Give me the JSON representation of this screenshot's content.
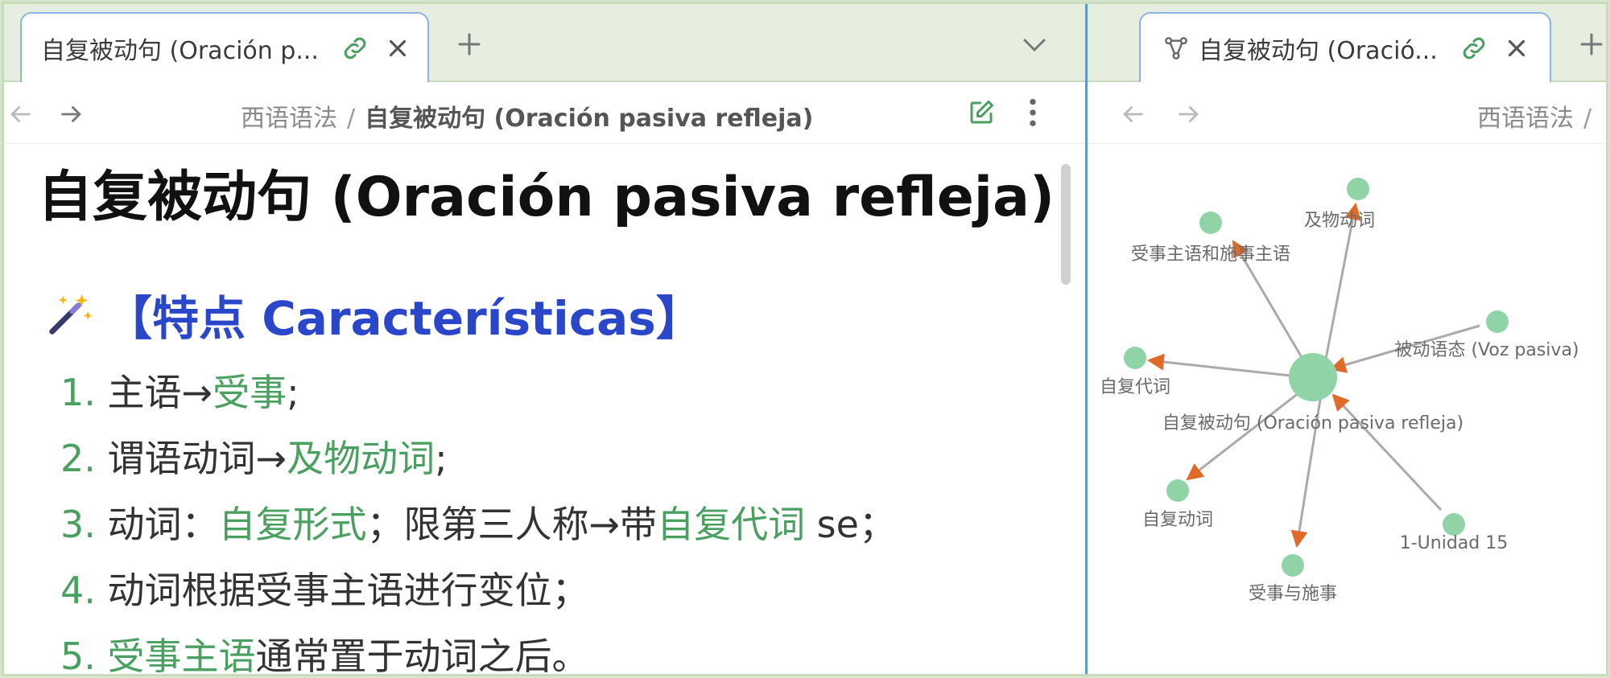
{
  "left_pane": {
    "tab": {
      "title": "自复被动句 (Oración p..."
    },
    "breadcrumb": {
      "parent": "西语语法",
      "separator": "/",
      "current": "自复被动句 (Oración pasiva refleja)"
    },
    "document": {
      "title": "自复被动句 (Oración pasiva refleja)",
      "section_heading": "【特点 Características】",
      "section_icon": "magic-wand-icon",
      "items": [
        {
          "number": "1.",
          "parts": [
            "主语→",
            "受事",
            ";"
          ]
        },
        {
          "number": "2.",
          "parts": [
            "谓语动词→",
            "及物动词",
            ";"
          ]
        },
        {
          "number": "3.",
          "parts": [
            "动词：",
            "自复形式",
            "；限第三人称→带",
            "自复代词",
            " se；"
          ]
        },
        {
          "number": "4.",
          "parts": [
            "动词根据受事主语进行变位；"
          ]
        },
        {
          "number": "5.",
          "parts": [
            "受事主语",
            "通常置于动词之后。"
          ]
        }
      ]
    }
  },
  "right_pane": {
    "tab": {
      "title": "自复被动句 (Oració...",
      "icon": "graph-view-icon"
    },
    "breadcrumb": {
      "parent": "西语语法",
      "separator": "/"
    },
    "graph": {
      "center": {
        "label": "自复被动句 (Oración pasiva refleja)"
      },
      "nodes": [
        {
          "id": "jiwu",
          "label": "及物动词"
        },
        {
          "id": "shoushi_zhuyu",
          "label": "受事主语和施事主语"
        },
        {
          "id": "beidong",
          "label": "被动语态 (Voz pasiva)"
        },
        {
          "id": "zifu_daici",
          "label": "自复代词"
        },
        {
          "id": "zifu_dongci",
          "label": "自复动词"
        },
        {
          "id": "unidad",
          "label": "1-Unidad 15"
        },
        {
          "id": "shoushi_shishi",
          "label": "受事与施事"
        }
      ]
    }
  },
  "colors": {
    "accent_green": "#4aa060",
    "heading_blue": "#2b47c9",
    "tab_border": "#8ab4e8",
    "node_fill": "#8fd3a6",
    "arrow": "#e06a2a"
  }
}
